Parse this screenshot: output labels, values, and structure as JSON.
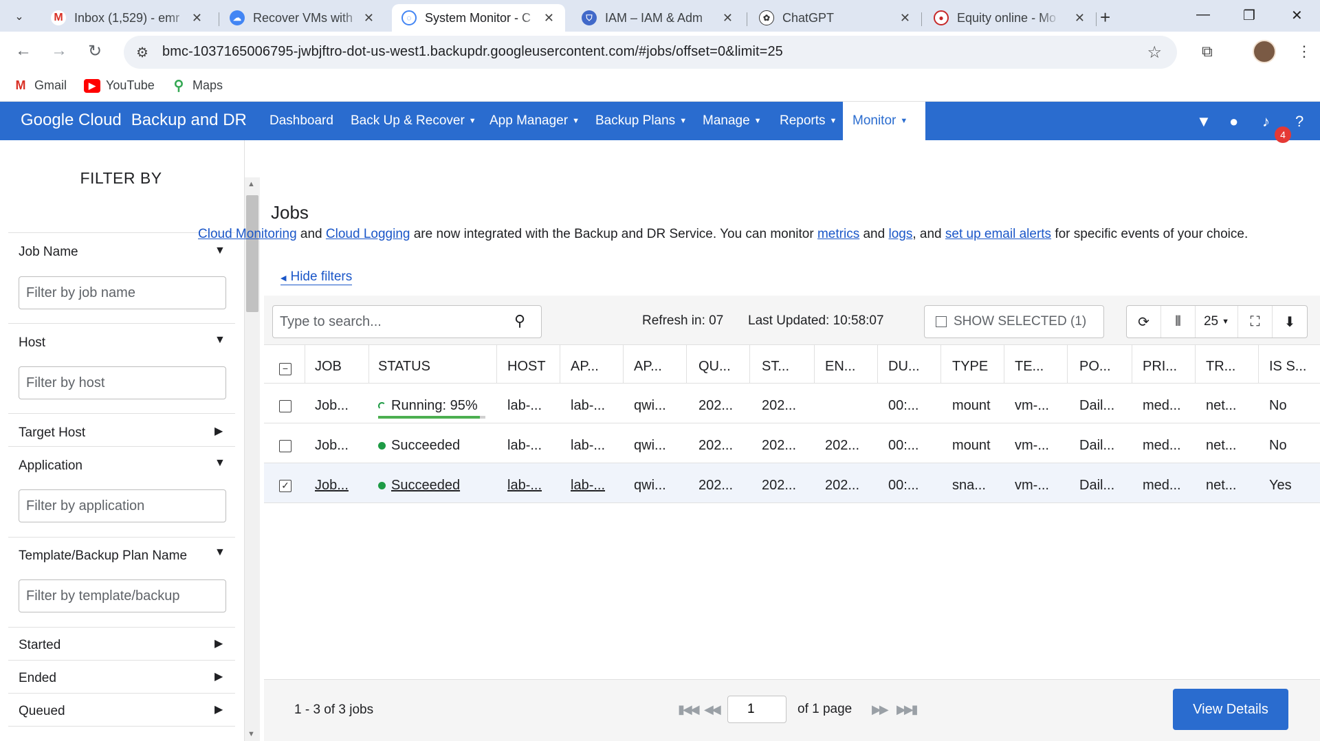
{
  "browser": {
    "tabs": [
      {
        "title": "Inbox (1,529) - emr",
        "favicon": "gmail-icon"
      },
      {
        "title": "Recover VMs with",
        "favicon": "google-cloud-icon"
      },
      {
        "title": "System Monitor - C",
        "favicon": "backup-dr-icon"
      },
      {
        "title": "IAM – IAM & Adm",
        "favicon": "iam-shield-icon"
      },
      {
        "title": "ChatGPT",
        "favicon": "chatgpt-icon"
      },
      {
        "title": "Equity online - Mo",
        "favicon": "equity-icon"
      }
    ],
    "url": "bmc-1037165006795-jwbjftro-dot-us-west1.backupdr.googleusercontent.com/#jobs/offset=0&limit=25",
    "bookmarks": [
      "Gmail",
      "YouTube",
      "Maps"
    ]
  },
  "app": {
    "brand": "Google Cloud",
    "product": "Backup and DR",
    "nav": [
      "Dashboard",
      "Back Up & Recover",
      "App Manager",
      "Backup Plans",
      "Manage",
      "Reports",
      "Monitor"
    ],
    "active_nav": "Monitor",
    "notification_count": "4",
    "accent_color": "#2a6ccf"
  },
  "sidebar": {
    "title": "FILTER BY",
    "filters": [
      {
        "label": "Job Name",
        "placeholder": "Filter by job name"
      },
      {
        "label": "Host",
        "placeholder": "Filter by host"
      },
      {
        "label": "Target Host"
      },
      {
        "label": "Application",
        "placeholder": "Filter by application"
      },
      {
        "label": "Template/Backup Plan Name",
        "placeholder": "Filter by template/backup"
      },
      {
        "label": "Started"
      },
      {
        "label": "Ended"
      },
      {
        "label": "Queued"
      }
    ]
  },
  "main": {
    "title": "Jobs",
    "notice": {
      "link1": "Cloud Monitoring",
      "t1": " and ",
      "link2": "Cloud Logging",
      "t2": " are now integrated with the Backup and DR Service. You can monitor ",
      "link3": "metrics",
      "t3": " and ",
      "link4": "logs",
      "t4": ", and ",
      "link5": "set up email alerts",
      "t5": " for specific events of your choice."
    },
    "hide_filters": "Hide filters",
    "search_placeholder": "Type to search...",
    "refresh": "Refresh in: 07",
    "last_updated": "Last Updated: 10:58:07",
    "show_selected": "SHOW SELECTED (1)",
    "page_size": "25",
    "columns": [
      "JOB",
      "STATUS",
      "HOST",
      "AP...",
      "AP...",
      "QU...",
      "ST...",
      "EN...",
      "DU...",
      "TYPE",
      "TE...",
      "PO...",
      "PRI...",
      "TR...",
      "IS S..."
    ],
    "rows": [
      {
        "job": "Job...",
        "status": "Running: 95%",
        "status_kind": "running",
        "progress": 0.95,
        "host": "lab-...",
        "ap1": "lab-...",
        "ap2": "qwi...",
        "queued": "202...",
        "started": "202...",
        "ended": "",
        "duration": "00:...",
        "type": "mount",
        "template": "vm-...",
        "policy": "Dail...",
        "priority": "med...",
        "transport": "net...",
        "is_s": "No",
        "selected": false
      },
      {
        "job": "Job...",
        "status": "Succeeded",
        "status_kind": "success",
        "host": "lab-...",
        "ap1": "lab-...",
        "ap2": "qwi...",
        "queued": "202...",
        "started": "202...",
        "ended": "202...",
        "duration": "00:...",
        "type": "mount",
        "template": "vm-...",
        "policy": "Dail...",
        "priority": "med...",
        "transport": "net...",
        "is_s": "No",
        "selected": false
      },
      {
        "job": "Job...",
        "status": "Succeeded",
        "status_kind": "success",
        "host": "lab-...",
        "ap1": "lab-...",
        "ap2": "qwi...",
        "queued": "202...",
        "started": "202...",
        "ended": "202...",
        "duration": "00:...",
        "type": "sna...",
        "template": "vm-...",
        "policy": "Dail...",
        "priority": "med...",
        "transport": "net...",
        "is_s": "Yes",
        "selected": true
      }
    ],
    "pagination": {
      "info": "1 - 3 of 3 jobs",
      "page": "1",
      "of_pages": "of 1 page"
    },
    "view_details": "View Details"
  }
}
